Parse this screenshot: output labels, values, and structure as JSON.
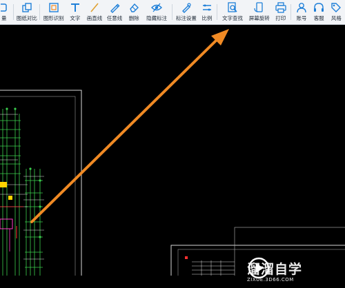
{
  "toolbar": {
    "items": [
      {
        "label": "量",
        "icon": "measure-icon"
      },
      {
        "label": "图纸对比",
        "icon": "compare-drawings-icon"
      },
      {
        "label": "图形识别",
        "icon": "shape-recognition-icon"
      },
      {
        "label": "文字",
        "icon": "text-icon"
      },
      {
        "label": "画直线",
        "icon": "line-icon"
      },
      {
        "label": "任意线",
        "icon": "freehand-line-icon"
      },
      {
        "label": "删除",
        "icon": "eraser-icon"
      },
      {
        "label": "隐藏标注",
        "icon": "hide-annotation-icon"
      },
      {
        "label": "标注设置",
        "icon": "annotation-settings-icon"
      },
      {
        "label": "比例",
        "icon": "scale-icon"
      },
      {
        "label": "文字查找",
        "icon": "text-search-icon"
      },
      {
        "label": "屏幕旋转",
        "icon": "screen-rotate-icon"
      },
      {
        "label": "打印",
        "icon": "print-icon"
      },
      {
        "label": "账号",
        "icon": "account-icon"
      },
      {
        "label": "客服",
        "icon": "customer-service-icon"
      },
      {
        "label": "风格",
        "icon": "style-icon"
      }
    ],
    "accent_color": "#1e7fd8"
  },
  "annotation": {
    "arrow_color": "#f08a24",
    "arrow_icon": "orange-arrow-pointing-to-text-search"
  },
  "watermark": {
    "name": "溜溜自学",
    "url": "ZIXUE.3D66.COM",
    "icon": "play-logo-icon"
  }
}
